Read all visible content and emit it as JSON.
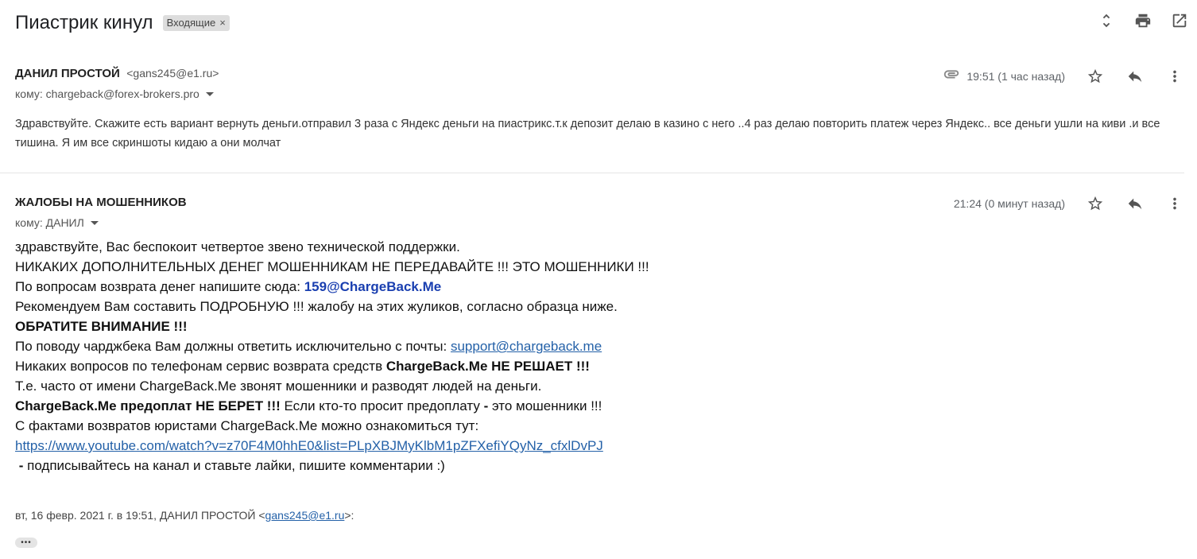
{
  "thread": {
    "subject": "Пиастрик кинул",
    "label": "Входящие",
    "label_remove": "×"
  },
  "top_icons": [
    "expand-collapse-icon",
    "print-icon",
    "open-in-new-window-icon"
  ],
  "messages": [
    {
      "sender_name": "ДАНИЛ ПРОСТОЙ",
      "sender_email": "<gans245@e1.ru>",
      "to": "кому: chargeback@forex-brokers.pro",
      "time": "19:51 (1 час назад)",
      "has_attachment": true,
      "body": "Здравствуйте. Скажите есть вариант вернуть деньги.отправил 3 раза с Яндекс деньги на пиастрикс.т.к депозит делаю в казино с него ..4 раз делаю повторить платеж через Яндекс.. все деньги ушли на киви .и все тишина. Я им все скриншоты кидаю а они молчат"
    },
    {
      "sender_name": "ЖАЛОБЫ НА МОШЕННИКОВ",
      "to": "кому: ДАНИЛ",
      "time": "21:24 (0 минут назад)",
      "lines": {
        "l1": "здравствуйте, Вас беспокоит четвертое звено технической поддержки.",
        "l2": "НИКАКИХ ДОПОЛНИТЕЛЬНЫХ ДЕНЕГ МОШЕННИКАМ НЕ ПЕРЕДАВАЙТЕ !!! ЭТО МОШЕННИКИ !!!",
        "l3_prefix": "По вопросам возврата денег напишите сюда: ",
        "l3_email": "159@ChargeBack.Me",
        "l4": "Рекомендуем Вам составить ПОДРОБНУЮ !!! жалобу на этих жуликов, согласно образца ниже.",
        "l5": "ОБРАТИТЕ ВНИМАНИЕ !!!",
        "l6_prefix": "По поводу чарджбека Вам должны ответить исключительно с почты: ",
        "l6_link": "support@chargeback.me",
        "l7_prefix": "Никаких вопросов по телефонам сервис возврата средств ",
        "l7_bold": "ChargeBack.Me НЕ РЕШАЕТ !!!",
        "l8": "Т.е. часто от имени ChargeBack.Me звонят мошенники и разводят людей на деньги.",
        "l9_bold": "ChargeBack.Me предоплат НЕ БЕРЕТ !!!",
        "l9_mid": " Если кто-то просит предоплату ",
        "l9_dash": "-",
        "l9_rest": " это мошенники !!!",
        "l10": "С фактами возвратов юристами ChargeBack.Me можно ознакомиться тут:",
        "l11_link": "https://www.youtube.com/watch?v=z70F4M0hhE0&list=PLpXBJMyKlbM1pZFXefiYQyNz_cfxlDvPJ",
        "l12_dash": " -",
        "l12_rest": " подписывайтесь на канал и ставьте лайки, пишите комментарии :)"
      },
      "quote_prefix": "вт, 16 февр. 2021 г. в 19:51, ДАНИЛ ПРОСТОЙ <",
      "quote_email": "gans245@e1.ru",
      "quote_suffix": ">:",
      "show_trimmed": "•••"
    }
  ]
}
